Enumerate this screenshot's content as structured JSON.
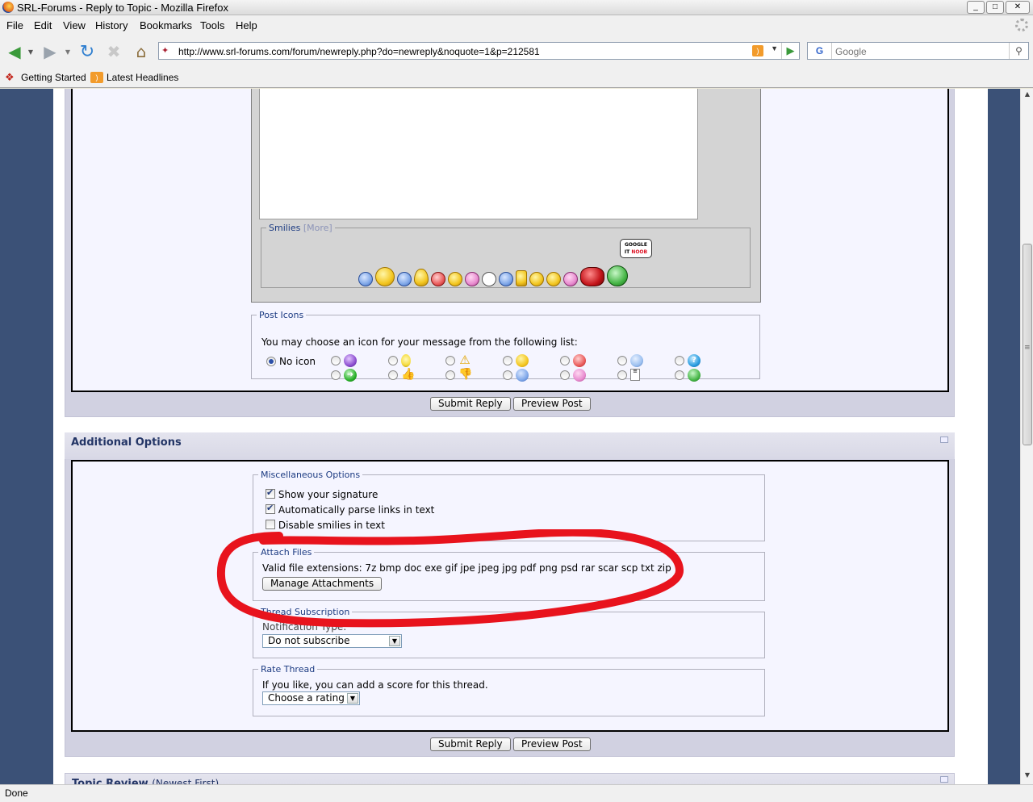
{
  "window": {
    "title": "SRL-Forums - Reply to Topic - Mozilla Firefox",
    "controls": [
      "_",
      "□",
      "✕"
    ]
  },
  "menu": [
    "File",
    "Edit",
    "View",
    "History",
    "Bookmarks",
    "Tools",
    "Help"
  ],
  "nav": {
    "url": "http://www.srl-forums.com/forum/newreply.php?do=newreply&noquote=1&p=212581",
    "search_placeholder": "Google",
    "search_engine": "G"
  },
  "bookmarks": [
    "Getting Started",
    "Latest Headlines"
  ],
  "smilies": {
    "legend": "Smilies",
    "more": "[More]",
    "count": 17,
    "bubble_line1": "GOOGLE",
    "bubble_line2_a": "IT",
    "bubble_line2_b": "NOOB"
  },
  "post_icons": {
    "legend": "Post Icons",
    "message": "You may choose an icon for your message from the following list:",
    "no_icon": "No icon",
    "icons": [
      "purple-face",
      "lightbulb",
      "warning",
      "smile",
      "angry",
      "cool",
      "question",
      "arrow-right",
      "thumbs-up",
      "thumbs-down",
      "happy",
      "grin",
      "document",
      "big-grin"
    ]
  },
  "buttons": {
    "submit": "Submit Reply",
    "preview": "Preview Post"
  },
  "additional": {
    "title": "Additional Options",
    "misc": {
      "legend": "Miscellaneous Options",
      "show_signature": "Show your signature",
      "parse_links": "Automatically parse links in text",
      "disable_smilies": "Disable smilies in text",
      "show_signature_checked": true,
      "parse_links_checked": true,
      "disable_smilies_checked": false
    },
    "attach": {
      "legend": "Attach Files",
      "valid": "Valid file extensions: 7z bmp doc exe gif jpe jpeg jpg pdf png psd rar scar scp txt zip",
      "manage": "Manage Attachments"
    },
    "subscription": {
      "legend": "Thread Subscription",
      "label": "Notification Type:",
      "selected": "Do not subscribe"
    },
    "rate": {
      "legend": "Rate Thread",
      "message": "If you like, you can add a score for this thread.",
      "selected": "Choose a rating"
    }
  },
  "topic_review": {
    "title": "Topic Review",
    "subtitle": "(Newest First)"
  },
  "status": "Done",
  "colors": {
    "page_bg": "#3b5177",
    "panel": "#d1d1e1",
    "panel_inner": "#f5f5ff",
    "heading": "#233566",
    "annotation": "#e8131d"
  }
}
